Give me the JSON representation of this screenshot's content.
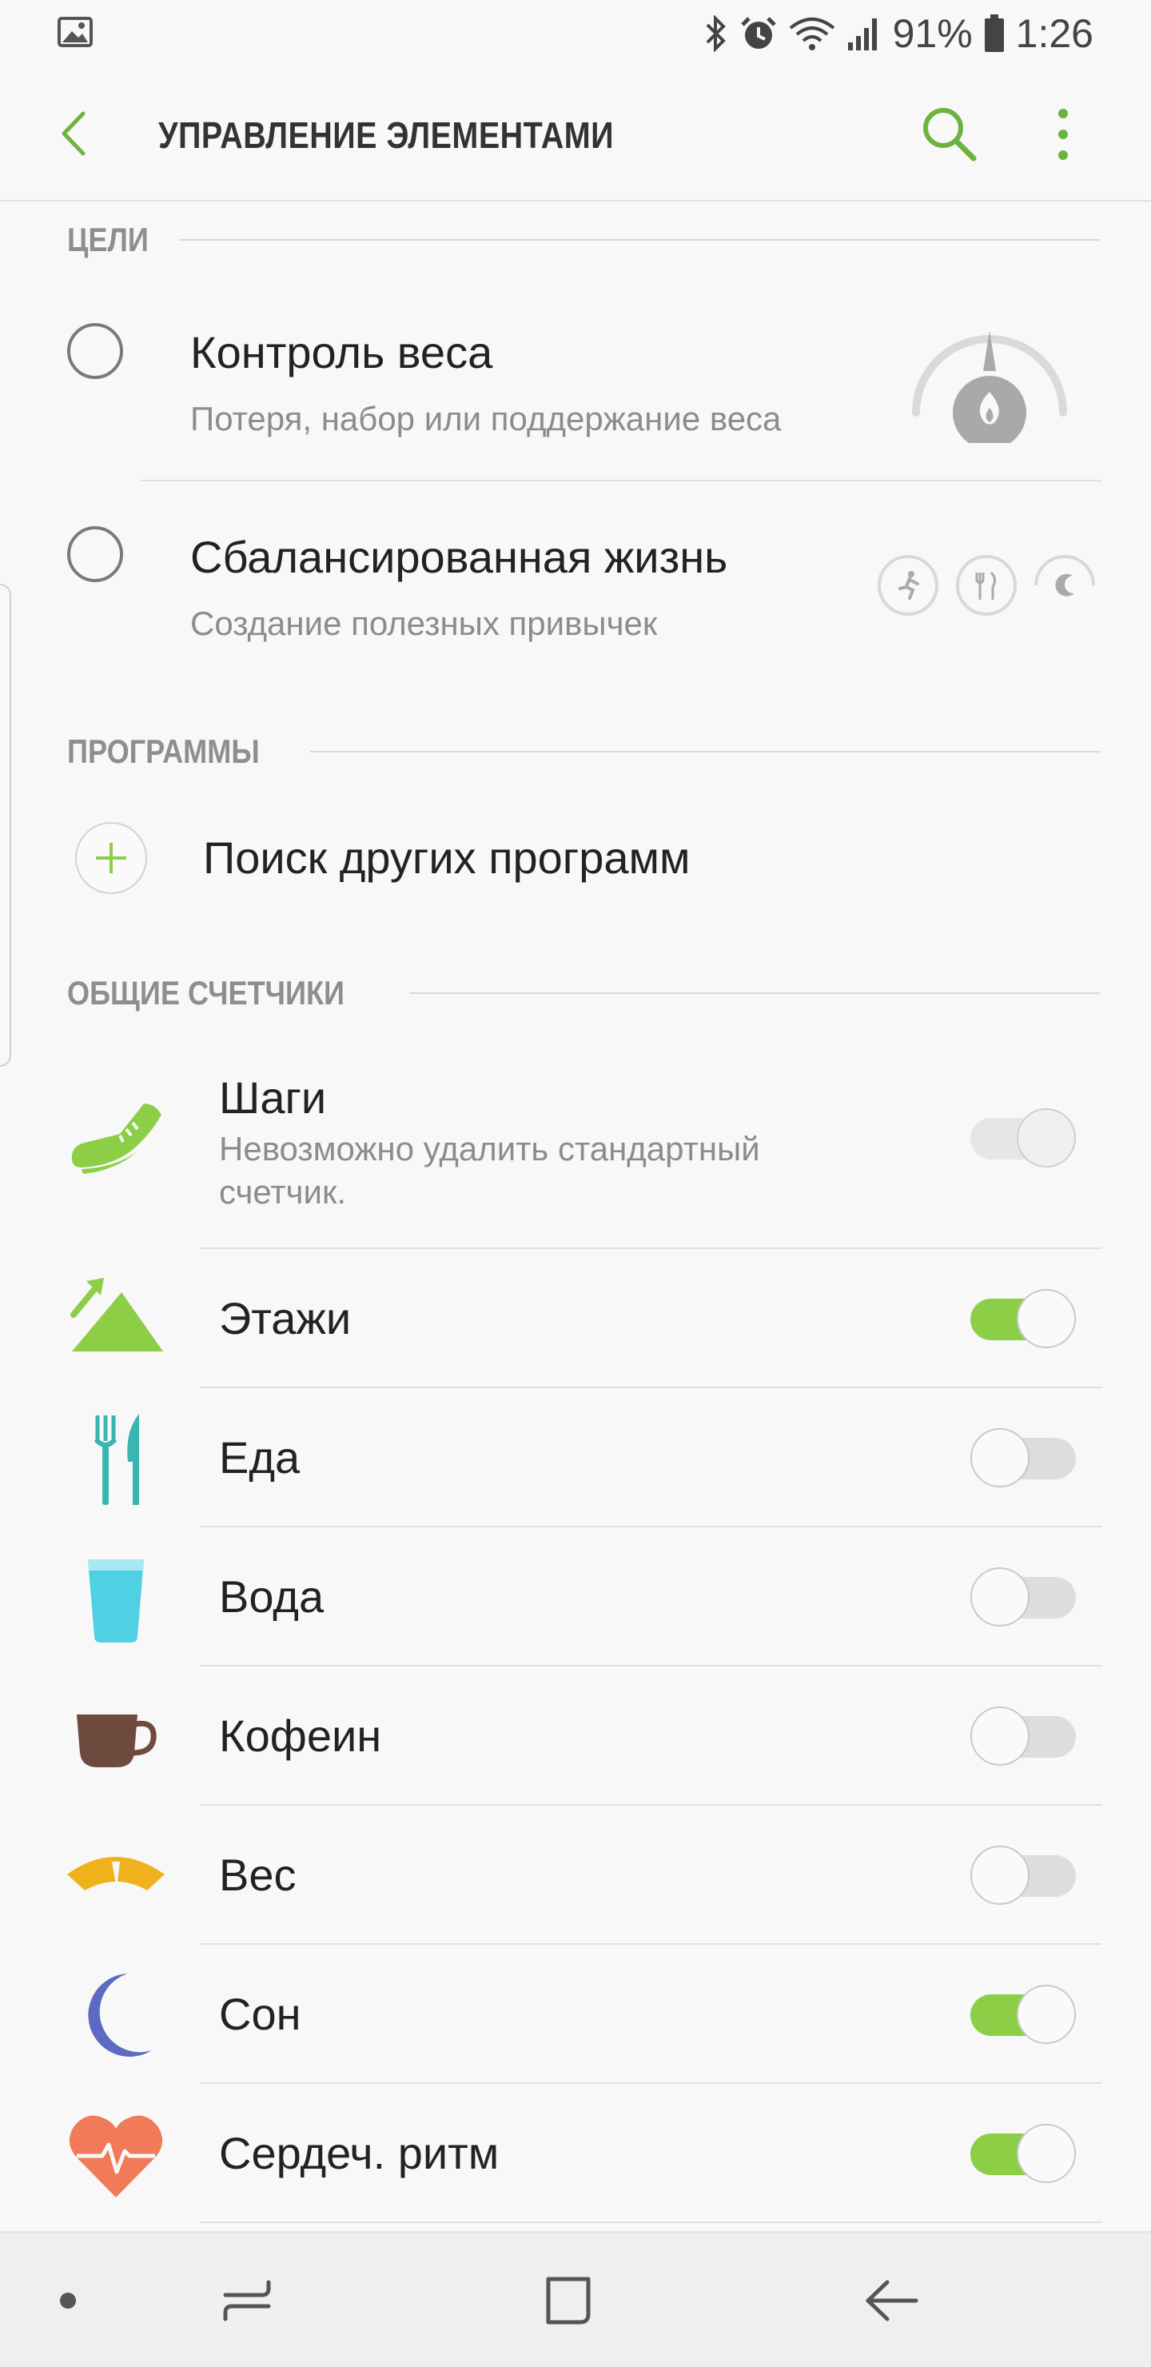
{
  "status_bar": {
    "battery": "91%",
    "time": "1:26",
    "icons": [
      "image-icon",
      "bluetooth-icon",
      "alarm-icon",
      "wifi-icon",
      "signal-icon",
      "battery-icon"
    ]
  },
  "app_bar": {
    "title": "УПРАВЛЕНИЕ ЭЛЕМЕНТАМИ",
    "accent": "#6db33f"
  },
  "sections": {
    "goals": "ЦЕЛИ",
    "programs": "ПРОГРАММЫ",
    "trackers": "ОБЩИЕ СЧЕТЧИКИ"
  },
  "goals": [
    {
      "title": "Контроль веса",
      "subtitle": "Потеря, набор или поддержание веса",
      "selected": false
    },
    {
      "title": "Сбалансированная жизнь",
      "subtitle": "Создание полезных привычек",
      "selected": false
    }
  ],
  "programs": {
    "find_more": "Поиск других программ"
  },
  "trackers": [
    {
      "label": "Шаги",
      "subtitle": "Невозможно удалить стандартный счетчик.",
      "state": "disabled",
      "icon": "shoe-icon",
      "color": "#8ccf46"
    },
    {
      "label": "Этажи",
      "state": "on",
      "icon": "mountain-icon",
      "color": "#8ccf46"
    },
    {
      "label": "Еда",
      "state": "off",
      "icon": "fork-knife-icon",
      "color": "#3ab5b0"
    },
    {
      "label": "Вода",
      "state": "off",
      "icon": "glass-icon",
      "color": "#4fd0e4"
    },
    {
      "label": "Кофеин",
      "state": "off",
      "icon": "cup-icon",
      "color": "#6d4a3d"
    },
    {
      "label": "Вес",
      "state": "off",
      "icon": "scale-icon",
      "color": "#f0b21c"
    },
    {
      "label": "Сон",
      "state": "on",
      "icon": "moon-icon",
      "color": "#5c6bc0"
    },
    {
      "label": "Сердеч. ритм",
      "state": "on",
      "icon": "heart-icon",
      "color": "#f07a5a"
    }
  ],
  "toggle_colors": {
    "on": "#8ccf46",
    "off": "#dddddd"
  }
}
